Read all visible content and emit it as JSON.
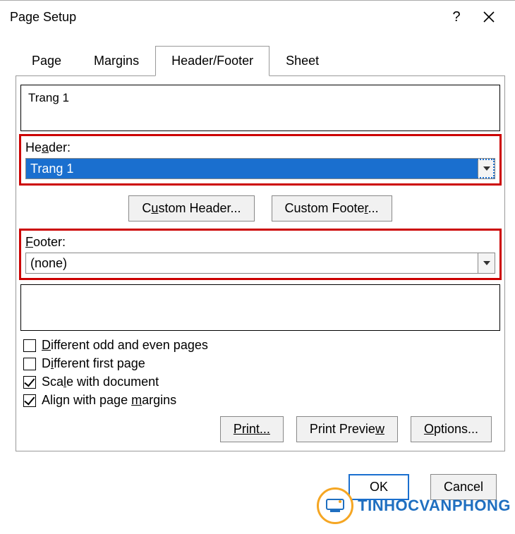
{
  "window": {
    "title": "Page Setup"
  },
  "tabs": {
    "page": "Page",
    "margins": "Margins",
    "header_footer": "Header/Footer",
    "sheet": "Sheet"
  },
  "preview": {
    "header_text": "Trang 1"
  },
  "header": {
    "label_pre": "He",
    "label_u": "a",
    "label_post": "der:",
    "value": "Trang 1"
  },
  "custom": {
    "header_pre": "C",
    "header_u": "u",
    "header_post": "stom Header...",
    "footer_pre": "Custom Foote",
    "footer_u": "r",
    "footer_post": "..."
  },
  "footer": {
    "label_u": "F",
    "label_post": "ooter:",
    "value": "(none)"
  },
  "checks": {
    "diff_odd_even": {
      "u": "D",
      "post": "ifferent odd and even pages",
      "checked": false
    },
    "diff_first": {
      "pre": "D",
      "u": "i",
      "post": "fferent first page",
      "checked": false
    },
    "scale": {
      "pre": "Sca",
      "u": "l",
      "post": "e with document",
      "checked": true
    },
    "align": {
      "pre": "Align with page ",
      "u": "m",
      "post": "argins",
      "checked": true
    }
  },
  "buttons": {
    "print": "Print...",
    "print_preview_pre": "Print Previe",
    "print_preview_u": "w",
    "options_u": "O",
    "options_post": "ptions...",
    "ok": "OK",
    "cancel": "Cancel"
  },
  "watermark": "TINHOCVANPHONG"
}
